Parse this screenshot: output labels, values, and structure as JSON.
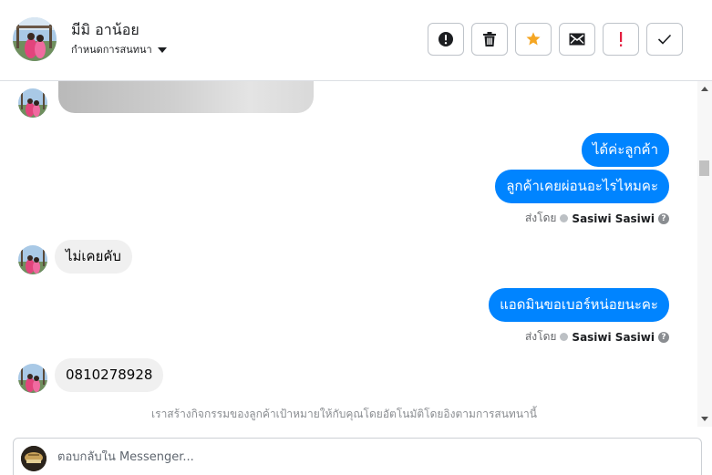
{
  "header": {
    "contact_name": "มีมิ อาน้อย",
    "assign_label": "กำหนดการสนทนา",
    "actions": [
      {
        "name": "mark-spam",
        "icon": "alert-circle-icon"
      },
      {
        "name": "delete",
        "icon": "trash-icon"
      },
      {
        "name": "star",
        "icon": "star-icon",
        "color": "#f5a623"
      },
      {
        "name": "mark-unread",
        "icon": "envelope-icon"
      },
      {
        "name": "follow-up",
        "icon": "exclamation-icon",
        "color": "#e41e3f"
      },
      {
        "name": "mark-done",
        "icon": "check-icon"
      }
    ]
  },
  "messages": [
    {
      "direction": "outgoing",
      "text": "ได้ค่ะลูกค้า"
    },
    {
      "direction": "outgoing",
      "text": "ลูกค้าเคยผ่อนอะไรไหมคะ"
    },
    {
      "direction": "incoming",
      "text": "ไม่เคยคับ"
    },
    {
      "direction": "outgoing",
      "text": "แอดมินขอเบอร์หน่อยนะคะ"
    },
    {
      "direction": "incoming",
      "text": "0810278928"
    }
  ],
  "sent_by": {
    "prefix": "ส่งโดย",
    "agent": "Sasiwi Sasiwi",
    "help": "?"
  },
  "system_note": "เราสร้างกิจกรรมของลูกค้าเป้าหมายให้กับคุณโดยอัตโนมัติโดยอิงตามการสนทนานี้",
  "composer": {
    "placeholder": "ตอบกลับใน Messenger..."
  },
  "colors": {
    "outgoing_bubble": "#0084ff",
    "incoming_bubble": "#f0f0f0"
  }
}
